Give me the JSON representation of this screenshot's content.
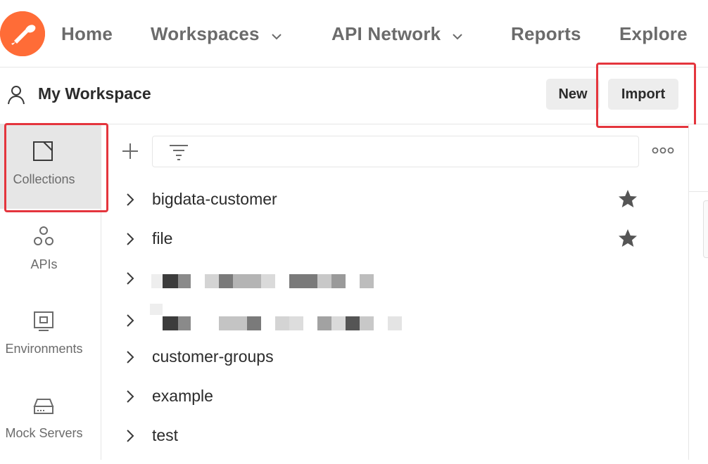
{
  "nav": {
    "home": "Home",
    "workspaces": "Workspaces",
    "api_network": "API Network",
    "reports": "Reports",
    "explore": "Explore"
  },
  "workspace": {
    "title": "My Workspace",
    "new_label": "New",
    "import_label": "Import"
  },
  "rail": [
    {
      "label": "Collections",
      "icon": "collections-icon",
      "active": true
    },
    {
      "label": "APIs",
      "icon": "apis-icon",
      "active": false
    },
    {
      "label": "Environments",
      "icon": "environments-icon",
      "active": false
    },
    {
      "label": "Mock Servers",
      "icon": "mock-servers-icon",
      "active": false
    }
  ],
  "collections": [
    {
      "name": "bigdata-customer",
      "starred": true
    },
    {
      "name": "file",
      "starred": true
    },
    {
      "name": "",
      "redacted": true
    },
    {
      "name": "",
      "redacted": true
    },
    {
      "name": "customer-groups",
      "starred": false
    },
    {
      "name": "example",
      "starred": false
    },
    {
      "name": "test",
      "starred": false
    }
  ],
  "colors": {
    "brand": "#ff6c37",
    "highlight": "#e4353d",
    "active_bg": "#e6e6e6"
  }
}
